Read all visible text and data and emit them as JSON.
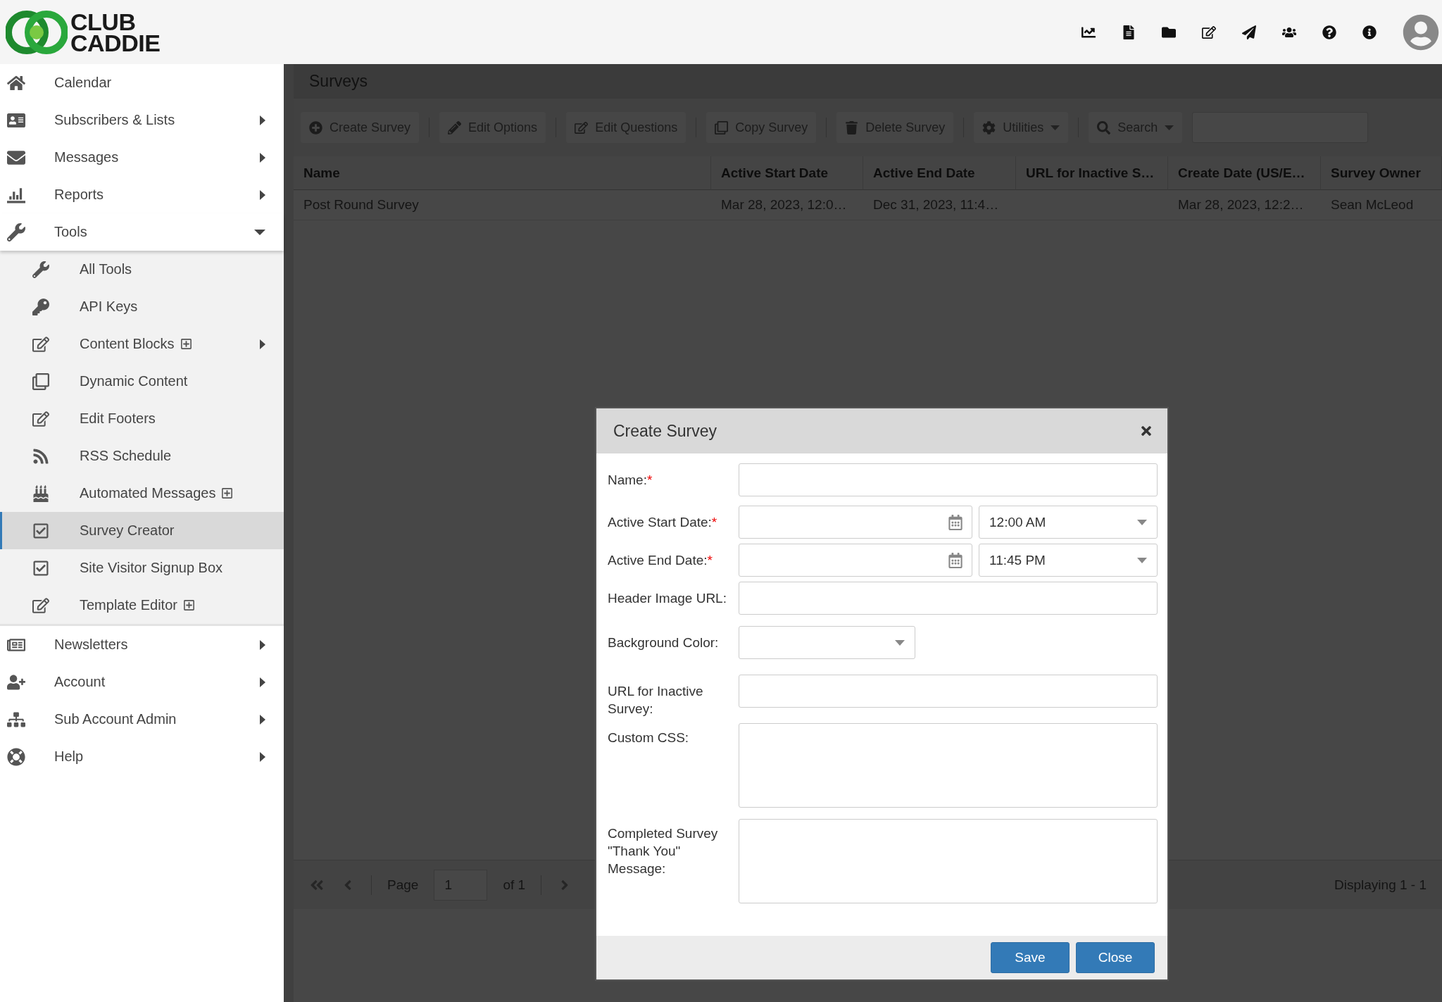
{
  "header": {
    "logo": {
      "line1": "CLUB",
      "line2": "CADDIE"
    }
  },
  "sidebar": {
    "items": [
      {
        "label": "Calendar",
        "selected": false,
        "submenu": false
      },
      {
        "label": "Subscribers & Lists",
        "selected": false,
        "submenu": true,
        "expanded": false
      },
      {
        "label": "Messages",
        "selected": false,
        "submenu": true,
        "expanded": false
      },
      {
        "label": "Reports",
        "selected": false,
        "submenu": true,
        "expanded": false
      },
      {
        "label": "Tools",
        "selected": false,
        "submenu": true,
        "expanded": true,
        "children": [
          {
            "label": "All Tools",
            "selected": false,
            "submenu": false,
            "plus": false
          },
          {
            "label": "API Keys",
            "selected": false,
            "submenu": false,
            "plus": false
          },
          {
            "label": "Content Blocks",
            "selected": false,
            "submenu": true,
            "plus": true
          },
          {
            "label": "Dynamic Content",
            "selected": false,
            "submenu": false,
            "plus": false
          },
          {
            "label": "Edit Footers",
            "selected": false,
            "submenu": false,
            "plus": false
          },
          {
            "label": "RSS Schedule",
            "selected": false,
            "submenu": false,
            "plus": false
          },
          {
            "label": "Automated Messages",
            "selected": false,
            "submenu": false,
            "plus": true
          },
          {
            "label": "Survey Creator",
            "selected": true,
            "submenu": false,
            "plus": false
          },
          {
            "label": "Site Visitor Signup Box",
            "selected": false,
            "submenu": false,
            "plus": false
          },
          {
            "label": "Template Editor",
            "selected": false,
            "submenu": false,
            "plus": true
          }
        ]
      },
      {
        "label": "Newsletters",
        "selected": false,
        "submenu": true,
        "expanded": false
      },
      {
        "label": "Account",
        "selected": false,
        "submenu": true,
        "expanded": false
      },
      {
        "label": "Sub Account Admin",
        "selected": false,
        "submenu": true,
        "expanded": false
      },
      {
        "label": "Help",
        "selected": false,
        "submenu": true,
        "expanded": false
      }
    ]
  },
  "panel": {
    "title": "Surveys",
    "toolbar": [
      {
        "label": "Create Survey",
        "dropdown": false
      },
      {
        "label": "Edit Options",
        "dropdown": false
      },
      {
        "label": "Edit Questions",
        "dropdown": false
      },
      {
        "label": "Copy Survey",
        "dropdown": false
      },
      {
        "label": "Delete Survey",
        "dropdown": false
      },
      {
        "label": "Utilities",
        "dropdown": true
      },
      {
        "label": "Search",
        "dropdown": true
      }
    ],
    "table": {
      "columns": [
        "Name",
        "Active Start Date",
        "Active End Date",
        "URL for Inactive S…",
        "Create Date (US/E…",
        "Survey Owner"
      ],
      "rows": [
        {
          "selected": false,
          "cells": [
            "Post Round Survey",
            "Mar 28, 2023, 12:0…",
            "Dec 31, 2023, 11:4…",
            "",
            "Mar 28, 2023, 12:2…",
            "Sean McLeod"
          ]
        }
      ]
    },
    "pager": {
      "page_label": "Page",
      "page": "1",
      "of": "of 1",
      "displaying": "Displaying 1 - 1"
    }
  },
  "dialog": {
    "title": "Create Survey",
    "required_mark": "*",
    "fields": [
      {
        "kind": "text",
        "label": "Name:",
        "required": true
      },
      {
        "kind": "datetime",
        "label": "Active Start Date:",
        "required": true,
        "time": "12:00 AM"
      },
      {
        "kind": "datetime",
        "label": "Active End Date:",
        "required": true,
        "time": "11:45 PM"
      },
      {
        "kind": "text",
        "label": "Header Image URL:",
        "required": false
      },
      {
        "kind": "select",
        "label": "Background Color:",
        "required": false
      },
      {
        "kind": "text",
        "label": "URL for Inactive Survey:",
        "required": false
      },
      {
        "kind": "textarea",
        "label": "Custom CSS:",
        "required": false
      },
      {
        "kind": "textarea",
        "label": "Completed Survey \"Thank You\" Message:",
        "required": false
      }
    ],
    "buttons": [
      "Save",
      "Close"
    ]
  }
}
